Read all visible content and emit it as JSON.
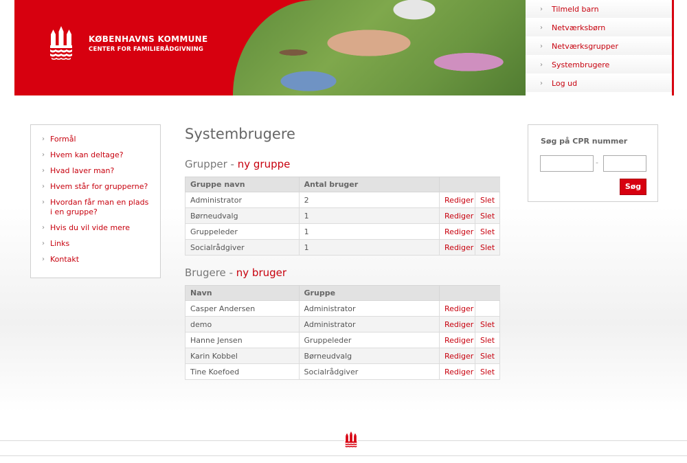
{
  "brand": {
    "title": "KØBENHAVNS KOMMUNE",
    "subtitle": "CENTER FOR FAMILIERÅDGIVNING",
    "color": "#d7000f"
  },
  "topnav": {
    "items": [
      {
        "label": "Tilmeld barn"
      },
      {
        "label": "Netværksbørn"
      },
      {
        "label": "Netværksgrupper"
      },
      {
        "label": "Systembrugere"
      },
      {
        "label": "Log ud"
      }
    ]
  },
  "leftmenu": {
    "items": [
      {
        "label": "Formål"
      },
      {
        "label": "Hvem kan deltage?"
      },
      {
        "label": "Hvad laver man?"
      },
      {
        "label": "Hvem står for grupperne?"
      },
      {
        "label": "Hvordan får man en plads i en gruppe?"
      },
      {
        "label": "Hvis du vil vide mere"
      },
      {
        "label": "Links"
      },
      {
        "label": "Kontakt"
      }
    ]
  },
  "main": {
    "title": "Systembrugere",
    "groups": {
      "heading": "Grupper",
      "separator": "-",
      "new_link": "ny gruppe",
      "columns": [
        "Gruppe navn",
        "Antal bruger"
      ],
      "rows": [
        {
          "name": "Administrator",
          "count": "2",
          "edit": "Rediger",
          "delete": "Slet"
        },
        {
          "name": "Børneudvalg",
          "count": "1",
          "edit": "Rediger",
          "delete": "Slet"
        },
        {
          "name": "Gruppeleder",
          "count": "1",
          "edit": "Rediger",
          "delete": "Slet"
        },
        {
          "name": "Socialrådgiver",
          "count": "1",
          "edit": "Rediger",
          "delete": "Slet"
        }
      ]
    },
    "users": {
      "heading": "Brugere",
      "separator": "-",
      "new_link": "ny bruger",
      "columns": [
        "Navn",
        "Gruppe"
      ],
      "rows": [
        {
          "name": "Casper Andersen",
          "group": "Administrator",
          "edit": "Rediger",
          "delete": ""
        },
        {
          "name": "demo",
          "group": "Administrator",
          "edit": "Rediger",
          "delete": "Slet"
        },
        {
          "name": "Hanne Jensen",
          "group": "Gruppeleder",
          "edit": "Rediger",
          "delete": "Slet"
        },
        {
          "name": "Karin Kobbel",
          "group": "Børneudvalg",
          "edit": "Rediger",
          "delete": "Slet"
        },
        {
          "name": "Tine Koefoed",
          "group": "Socialrådgiver",
          "edit": "Rediger",
          "delete": "Slet"
        }
      ]
    }
  },
  "search": {
    "title": "Søg på CPR nummer",
    "field1_value": "",
    "field2_value": "",
    "separator": "-",
    "button_label": "Søg"
  },
  "icons": {
    "arrow": "›",
    "crest": "copenhagen-crest-icon"
  }
}
